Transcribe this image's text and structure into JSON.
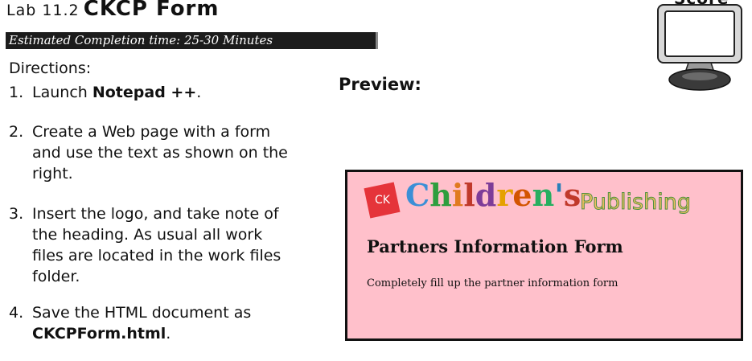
{
  "header": {
    "lab_prefix": "Lab 11.2",
    "lab_name": "CKCP Form",
    "estimated_time": "Estimated Completion time: 25-30 Minutes"
  },
  "score": {
    "label": "Score"
  },
  "directions": {
    "heading": "Directions:",
    "steps": [
      {
        "num": "1.",
        "pre": "Launch ",
        "bold": "Notepad ++",
        "post": "."
      },
      {
        "num": "2.",
        "text": "Create a Web page with a form and use the text as shown on the right."
      },
      {
        "num": "3.",
        "text": "Insert the logo, and take note of the heading. As usual all work files are located in the work files folder."
      },
      {
        "num": "4.",
        "pre": "Save the HTML document as ",
        "bold": "CKCPForm.html",
        "post": "."
      }
    ]
  },
  "preview": {
    "label": "Preview:",
    "logo": {
      "badge": "CK",
      "word1": "Children's",
      "word2": "Publishing"
    },
    "form_heading": "Partners Information Form",
    "form_text": "Completely fill up the partner information form"
  },
  "colors": {
    "preview_background": "#ffc0cb",
    "logo_badge": "#e5343a",
    "time_bar": "#1c1c1c"
  }
}
